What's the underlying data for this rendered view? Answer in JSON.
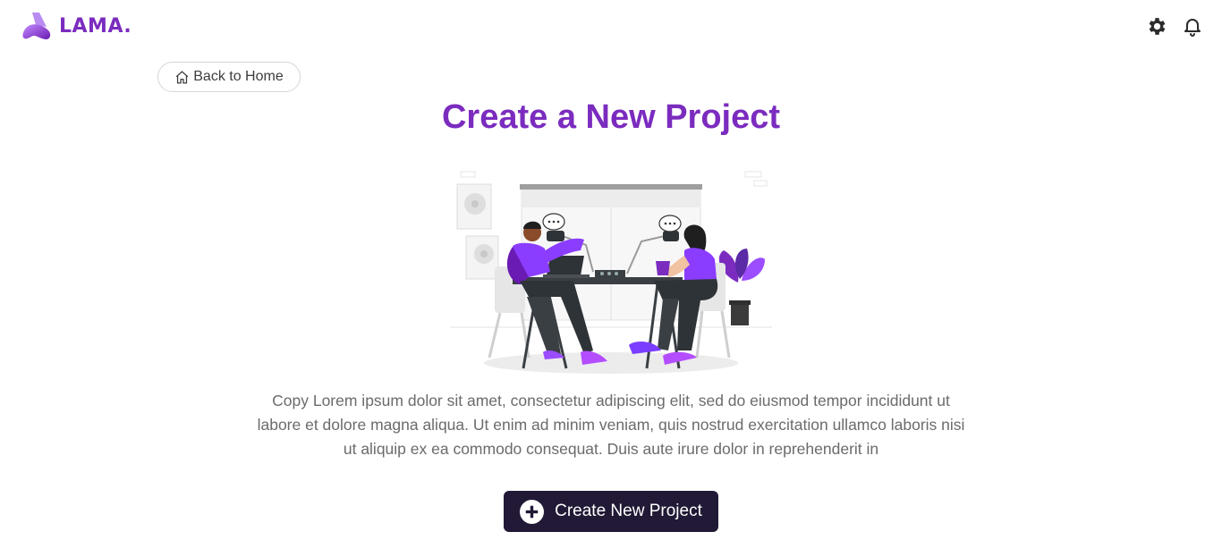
{
  "app": {
    "name": "LAMA."
  },
  "header": {
    "icons": [
      "gear-icon",
      "bell-icon"
    ]
  },
  "nav": {
    "back_label": "Back to Home"
  },
  "main": {
    "title": "Create a New Project",
    "description": "Copy Lorem ipsum dolor sit amet, consectetur adipiscing elit, sed do eiusmod tempor incididunt ut labore et dolore magna aliqua. Ut enim ad minim veniam, quis nostrud exercitation ullamco laboris nisi ut aliquip ex ea commodo consequat. Duis aute irure dolor in reprehenderit in",
    "create_button_label": "Create New Project"
  },
  "colors": {
    "brand": "#7B2CBF",
    "button_bg": "#211935",
    "text_muted": "#6b6b6b"
  }
}
